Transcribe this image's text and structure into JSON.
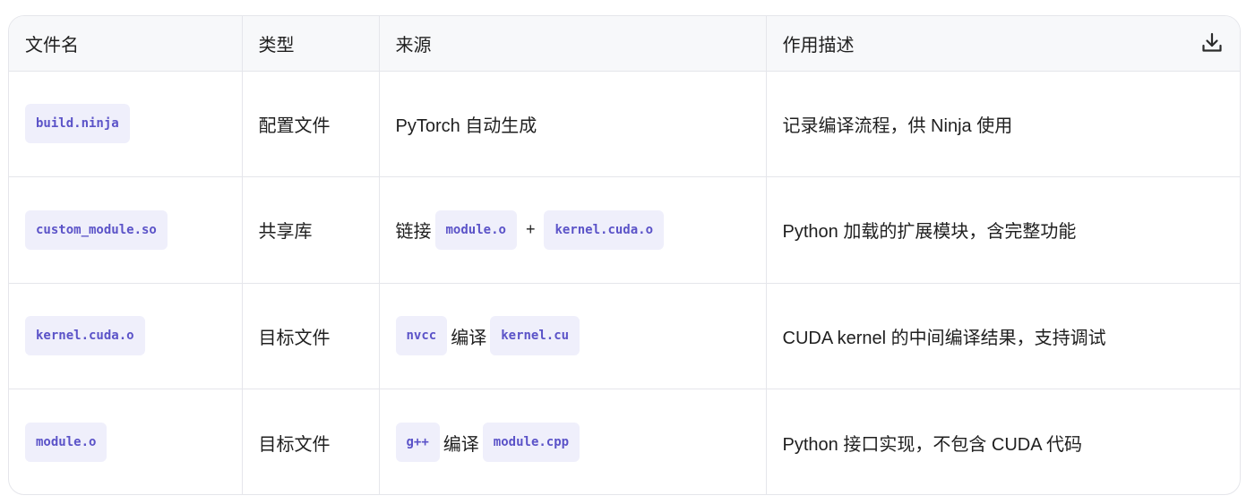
{
  "table": {
    "headers": [
      "文件名",
      "类型",
      "来源",
      "作用描述"
    ],
    "download_icon": "download-icon",
    "rows": [
      {
        "filename": "build.ninja",
        "type": "配置文件",
        "source": {
          "text": "PyTorch 自动生成"
        },
        "description": "记录编译流程，供 Ninja 使用"
      },
      {
        "filename": "custom_module.so",
        "type": "共享库",
        "source": {
          "prefix": "链接",
          "code1": "module.o",
          "joiner": "+",
          "code2": "kernel.cuda.o"
        },
        "description": "Python 加载的扩展模块，含完整功能"
      },
      {
        "filename": "kernel.cuda.o",
        "type": "目标文件",
        "source": {
          "code1": "nvcc",
          "joiner": "编译",
          "code2": "kernel.cu"
        },
        "description": "CUDA kernel 的中间编译结果，支持调试"
      },
      {
        "filename": "module.o",
        "type": "目标文件",
        "source": {
          "code1": "g++",
          "joiner": "编译",
          "code2": "module.cpp"
        },
        "description": "Python 接口实现，不包含 CUDA 代码"
      }
    ]
  },
  "colors": {
    "code_bg": "#efeffb",
    "code_text": "#5b53c8",
    "header_bg": "#f7f8fa",
    "border": "#e5e6eb"
  }
}
